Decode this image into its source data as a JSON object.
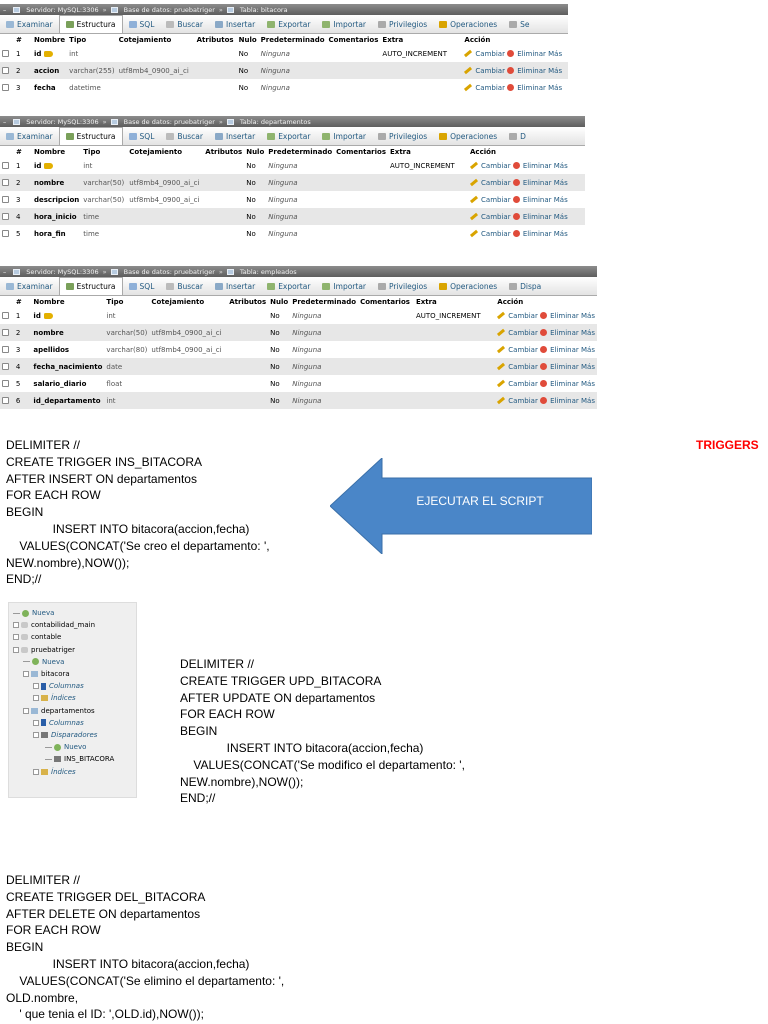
{
  "panels": [
    {
      "breadcrumb": [
        "Servidor: MySQL:3306",
        "Base de datos: pruebatriger",
        "Tabla: bitacora"
      ],
      "tabs": [
        "Examinar",
        "Estructura",
        "SQL",
        "Buscar",
        "Insertar",
        "Exportar",
        "Importar",
        "Privilegios",
        "Operaciones",
        "Se"
      ],
      "headers": [
        "#",
        "Nombre",
        "Tipo",
        "Cotejamiento",
        "Atributos",
        "Nulo",
        "Predeterminado",
        "Comentarios",
        "Extra",
        "Acción"
      ],
      "rows": [
        {
          "num": "1",
          "name": "id",
          "type": "int",
          "collation": "",
          "attributes": "",
          "null": "No",
          "default": "Ninguna",
          "extra": "AUTO_INCREMENT",
          "key": true
        },
        {
          "num": "2",
          "name": "accion",
          "type": "varchar(255)",
          "collation": "utf8mb4_0900_ai_ci",
          "attributes": "",
          "null": "No",
          "default": "Ninguna",
          "extra": "",
          "key": false
        },
        {
          "num": "3",
          "name": "fecha",
          "type": "datetime",
          "collation": "",
          "attributes": "",
          "null": "No",
          "default": "Ninguna",
          "extra": "",
          "key": false
        }
      ]
    },
    {
      "breadcrumb": [
        "Servidor: MySQL:3306",
        "Base de datos: pruebatriger",
        "Tabla: departamentos"
      ],
      "tabs": [
        "Examinar",
        "Estructura",
        "SQL",
        "Buscar",
        "Insertar",
        "Exportar",
        "Importar",
        "Privilegios",
        "Operaciones",
        "D"
      ],
      "headers": [
        "#",
        "Nombre",
        "Tipo",
        "Cotejamiento",
        "Atributos",
        "Nulo",
        "Predeterminado",
        "Comentarios",
        "Extra",
        "Acción"
      ],
      "rows": [
        {
          "num": "1",
          "name": "id",
          "type": "int",
          "collation": "",
          "attributes": "",
          "null": "No",
          "default": "Ninguna",
          "extra": "AUTO_INCREMENT",
          "key": true
        },
        {
          "num": "2",
          "name": "nombre",
          "type": "varchar(50)",
          "collation": "utf8mb4_0900_ai_ci",
          "attributes": "",
          "null": "No",
          "default": "Ninguna",
          "extra": "",
          "key": false
        },
        {
          "num": "3",
          "name": "descripcion",
          "type": "varchar(50)",
          "collation": "utf8mb4_0900_ai_ci",
          "attributes": "",
          "null": "No",
          "default": "Ninguna",
          "extra": "",
          "key": false
        },
        {
          "num": "4",
          "name": "hora_inicio",
          "type": "time",
          "collation": "",
          "attributes": "",
          "null": "No",
          "default": "Ninguna",
          "extra": "",
          "key": false
        },
        {
          "num": "5",
          "name": "hora_fin",
          "type": "time",
          "collation": "",
          "attributes": "",
          "null": "No",
          "default": "Ninguna",
          "extra": "",
          "key": false
        }
      ]
    },
    {
      "breadcrumb": [
        "Servidor: MySQL:3306",
        "Base de datos: pruebatriger",
        "Tabla: empleados"
      ],
      "tabs": [
        "Examinar",
        "Estructura",
        "SQL",
        "Buscar",
        "Insertar",
        "Exportar",
        "Importar",
        "Privilegios",
        "Operaciones",
        "Dispa"
      ],
      "headers": [
        "#",
        "Nombre",
        "Tipo",
        "Cotejamiento",
        "Atributos",
        "Nulo",
        "Predeterminado",
        "Comentarios",
        "Extra",
        "Acción"
      ],
      "rows": [
        {
          "num": "1",
          "name": "id",
          "type": "int",
          "collation": "",
          "attributes": "",
          "null": "No",
          "default": "Ninguna",
          "extra": "AUTO_INCREMENT",
          "key": true
        },
        {
          "num": "2",
          "name": "nombre",
          "type": "varchar(50)",
          "collation": "utf8mb4_0900_ai_ci",
          "attributes": "",
          "null": "No",
          "default": "Ninguna",
          "extra": "",
          "key": false
        },
        {
          "num": "3",
          "name": "apellidos",
          "type": "varchar(80)",
          "collation": "utf8mb4_0900_ai_ci",
          "attributes": "",
          "null": "No",
          "default": "Ninguna",
          "extra": "",
          "key": false
        },
        {
          "num": "4",
          "name": "fecha_nacimiento",
          "type": "date",
          "collation": "",
          "attributes": "",
          "null": "No",
          "default": "Ninguna",
          "extra": "",
          "key": false
        },
        {
          "num": "5",
          "name": "salario_diario",
          "type": "float",
          "collation": "",
          "attributes": "",
          "null": "No",
          "default": "Ninguna",
          "extra": "",
          "key": false
        },
        {
          "num": "6",
          "name": "id_departamento",
          "type": "int",
          "collation": "",
          "attributes": "",
          "null": "No",
          "default": "Ninguna",
          "extra": "",
          "key": false
        }
      ]
    }
  ],
  "actions": {
    "change": "Cambiar",
    "drop": "Eliminar",
    "more": "Más"
  },
  "triggers_title": "TRIGGERS",
  "arrow_label": "EJECUTAR EL SCRIPT",
  "scripts": [
    "DELIMITER //\nCREATE TRIGGER INS_BITACORA\nAFTER INSERT ON departamentos\nFOR EACH ROW\nBEGIN\n              INSERT INTO bitacora(accion,fecha)\n    VALUES(CONCAT('Se creo el departamento: ',\nNEW.nombre),NOW());\nEND;//",
    "DELIMITER //\nCREATE TRIGGER UPD_BITACORA\nAFTER UPDATE ON departamentos\nFOR EACH ROW\nBEGIN\n              INSERT INTO bitacora(accion,fecha)\n    VALUES(CONCAT('Se modifico el departamento: ',\nNEW.nombre),NOW());\nEND;//",
    "DELIMITER //\nCREATE TRIGGER DEL_BITACORA\nAFTER DELETE ON departamentos\nFOR EACH ROW\nBEGIN\n              INSERT INTO bitacora(accion,fecha)\n    VALUES(CONCAT('Se elimino el departamento: ',\nOLD.nombre,\n    ' que tenia el ID: ',OLD.id),NOW());"
  ],
  "tree": [
    {
      "label": "Nueva",
      "depth": 0,
      "icon": "new",
      "style": "lnk"
    },
    {
      "label": "contabilidad_main",
      "depth": 0,
      "icon": "db",
      "style": ""
    },
    {
      "label": "contable",
      "depth": 0,
      "icon": "db",
      "style": ""
    },
    {
      "label": "pruebatriger",
      "depth": 0,
      "icon": "db",
      "style": ""
    },
    {
      "label": "Nueva",
      "depth": 1,
      "icon": "new",
      "style": "lnk"
    },
    {
      "label": "bitacora",
      "depth": 1,
      "icon": "table",
      "style": ""
    },
    {
      "label": "Columnas",
      "depth": 2,
      "icon": "col",
      "style": "it"
    },
    {
      "label": "Índices",
      "depth": 2,
      "icon": "idx",
      "style": "it"
    },
    {
      "label": "departamentos",
      "depth": 1,
      "icon": "table",
      "style": ""
    },
    {
      "label": "Columnas",
      "depth": 2,
      "icon": "col",
      "style": "it"
    },
    {
      "label": "Disparadores",
      "depth": 2,
      "icon": "trg",
      "style": "it"
    },
    {
      "label": "Nuevo",
      "depth": 3,
      "icon": "new",
      "style": "lnk"
    },
    {
      "label": "INS_BITACORA",
      "depth": 3,
      "icon": "trg",
      "style": ""
    },
    {
      "label": "Índices",
      "depth": 2,
      "icon": "idx",
      "style": "it"
    }
  ]
}
